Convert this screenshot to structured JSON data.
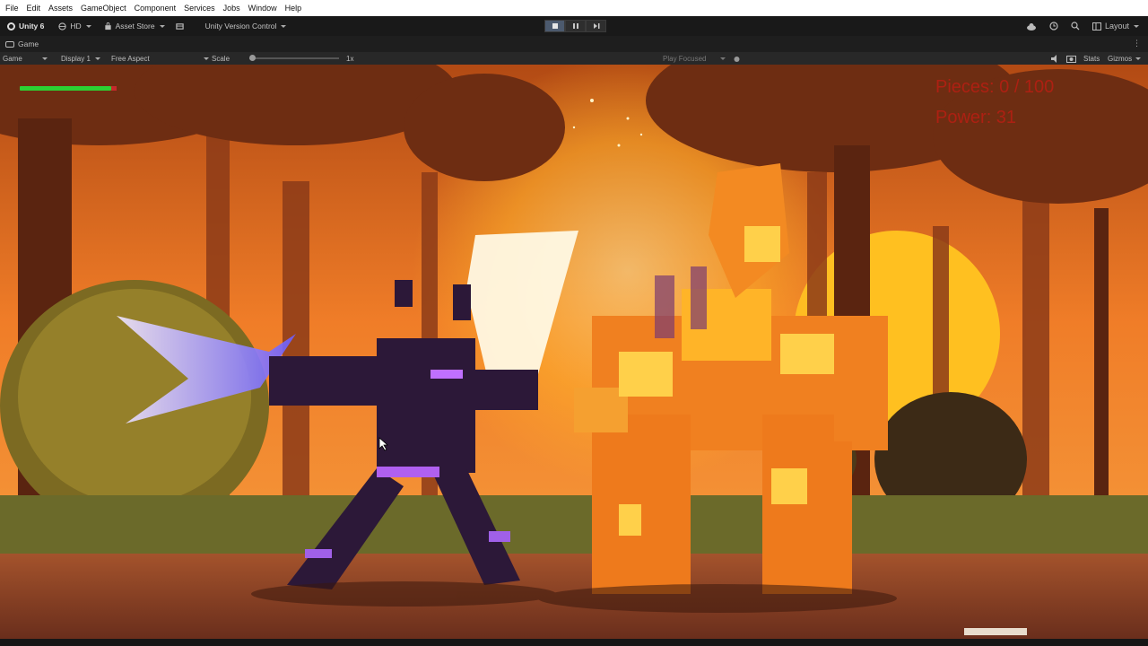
{
  "menu": [
    "File",
    "Edit",
    "Assets",
    "GameObject",
    "Component",
    "Services",
    "Jobs",
    "Window",
    "Help"
  ],
  "toolbar": {
    "account": "Unity 6",
    "quality": "HD",
    "asset_store": "Asset Store",
    "version_control": "Unity Version Control",
    "layout": "Layout"
  },
  "tab": {
    "label": "Game"
  },
  "gamebar": {
    "view_mode": "Game",
    "display": "Display 1",
    "aspect": "Free Aspect",
    "scale_label": "Scale",
    "scale_value": "1x",
    "play_mode": "Play Focused",
    "stats": "Stats",
    "gizmos": "Gizmos"
  },
  "hud": {
    "health_fraction": 0.93,
    "pieces": "Pieces: 0 / 100",
    "power": "Power: 31"
  },
  "colors": {
    "health": "#2bd233",
    "hud_text": "#b81e12",
    "sky": "#f07d28",
    "sun": "#ffc020"
  }
}
